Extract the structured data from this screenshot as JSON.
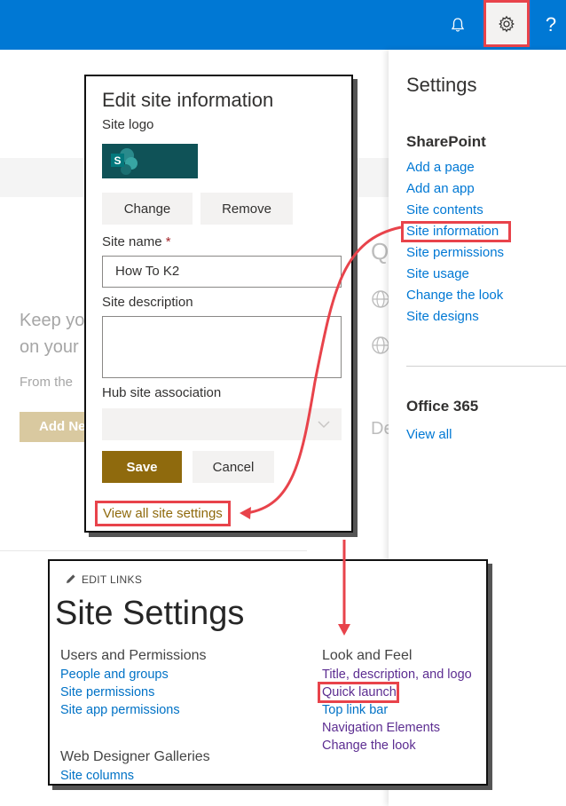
{
  "topbar": {
    "bell_icon": "bell-icon",
    "gear_icon": "gear-icon",
    "help_label": "?"
  },
  "background": {
    "text_line1": "Keep yo",
    "text_line2": "on your",
    "text_line3": "From the",
    "button_label": "Add Ne",
    "letter_do": "De"
  },
  "settings_panel": {
    "title": "Settings",
    "sharepoint_header": "SharePoint",
    "sharepoint_links": [
      "Add a page",
      "Add an app",
      "Site contents",
      "Site information",
      "Site permissions",
      "Site usage",
      "Change the look",
      "Site designs"
    ],
    "office_header": "Office 365",
    "office_link": "View all"
  },
  "edit_dialog": {
    "title": "Edit site information",
    "logo_label": "Site logo",
    "change_button": "Change",
    "remove_button": "Remove",
    "site_name_label": "Site name",
    "required_marker": "*",
    "site_name_value": "How To K2",
    "description_label": "Site description",
    "description_value": "",
    "hub_label": "Hub site association",
    "save_button": "Save",
    "cancel_button": "Cancel",
    "view_all_link": "View all site settings"
  },
  "site_settings": {
    "edit_links": "EDIT LINKS",
    "title": "Site Settings",
    "users_section": "Users and Permissions",
    "users_links": [
      "People and groups",
      "Site permissions",
      "Site app permissions"
    ],
    "web_designer_section": "Web Designer Galleries",
    "web_designer_links": [
      "Site columns"
    ],
    "look_section": "Look and Feel",
    "look_links": [
      "Title, description, and logo",
      "Quick launch",
      "Top link bar",
      "Navigation Elements",
      "Change the look"
    ]
  },
  "colors": {
    "suite_bar": "#0078d4",
    "link": "#0078d4",
    "highlight": "#e8434b",
    "theme_gold": "#8f6a0d"
  }
}
